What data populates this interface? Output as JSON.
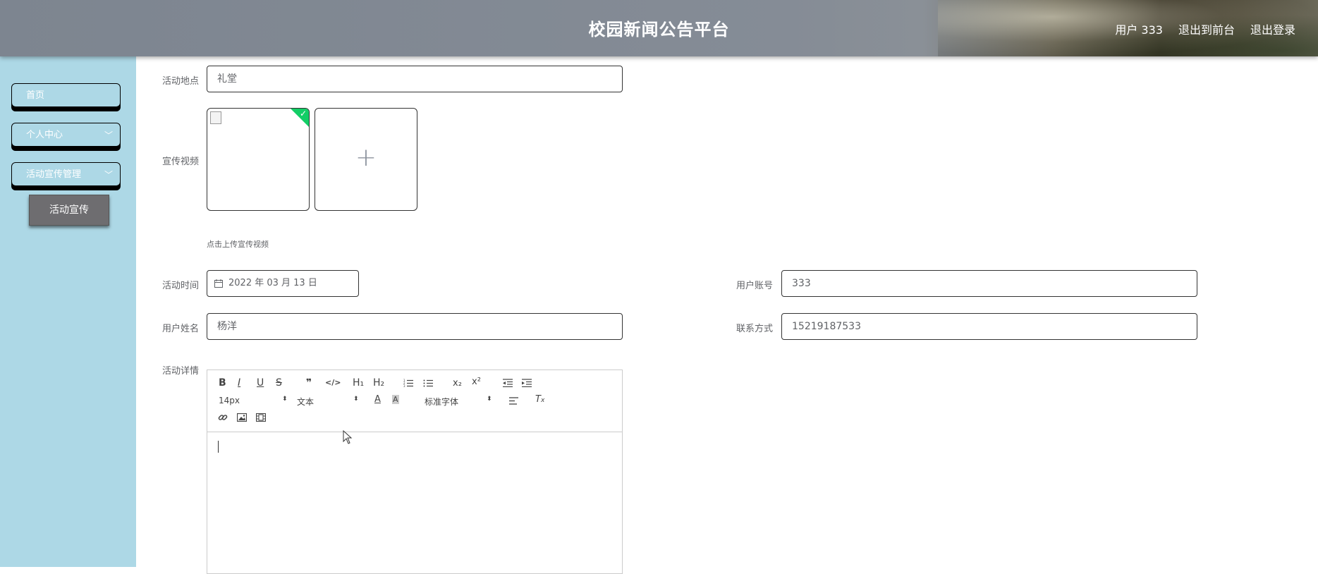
{
  "header": {
    "title": "校园新闻公告平台",
    "nav": [
      "用户 333",
      "退出到前台",
      "退出登录"
    ]
  },
  "sidebar": {
    "items": [
      {
        "label": "首页"
      },
      {
        "label": "个人中心"
      },
      {
        "label": "活动宣传管理"
      }
    ],
    "sub_item": "活动宣传"
  },
  "form": {
    "location": {
      "label": "活动地点",
      "value": "礼堂"
    },
    "video": {
      "label": "宣传视频",
      "tip": "点击上传宣传视频"
    },
    "time": {
      "label": "活动时间",
      "value": "2022 年 03 月 13 日"
    },
    "account": {
      "label": "用户账号",
      "value": "333"
    },
    "name": {
      "label": "用户姓名",
      "value": "杨洋"
    },
    "contact": {
      "label": "联系方式",
      "value": "15219187533"
    },
    "details": {
      "label": "活动详情"
    }
  },
  "editor": {
    "font_size": "14px",
    "paragraph": "文本",
    "font_family": "标准字体",
    "buttons": {
      "bold": "B",
      "italic": "I",
      "underline": "U",
      "strike": "S",
      "quote": "❞",
      "code": "</>",
      "h1": "H₁",
      "h2": "H₂",
      "sub": "x₂",
      "sup": "x²"
    }
  },
  "colors": {
    "sidebar_bg": "#add8e6",
    "active_sub_bg": "#6e6d70",
    "success": "#13ce66"
  }
}
